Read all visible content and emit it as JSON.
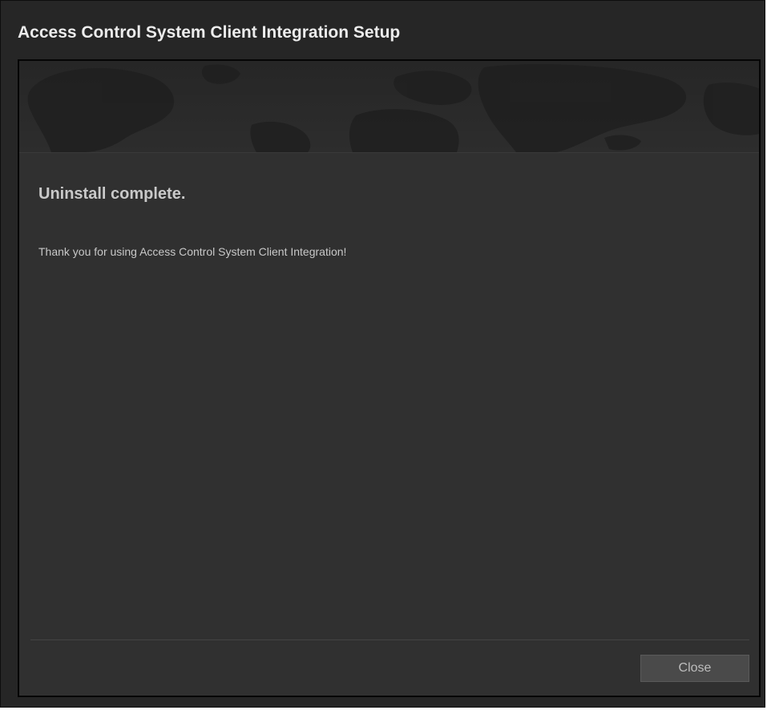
{
  "window": {
    "title": "Access Control System Client Integration Setup"
  },
  "banner": {
    "image": "world-map-banner"
  },
  "main": {
    "heading": "Uninstall complete.",
    "message": "Thank you for using Access Control System Client Integration!"
  },
  "footer": {
    "close_label": "Close"
  },
  "colors": {
    "window_bg": "#262626",
    "panel_bg": "#303030",
    "title_text": "#ececec",
    "body_text": "#c8c8c8",
    "button_bg": "#4a4a4a"
  }
}
